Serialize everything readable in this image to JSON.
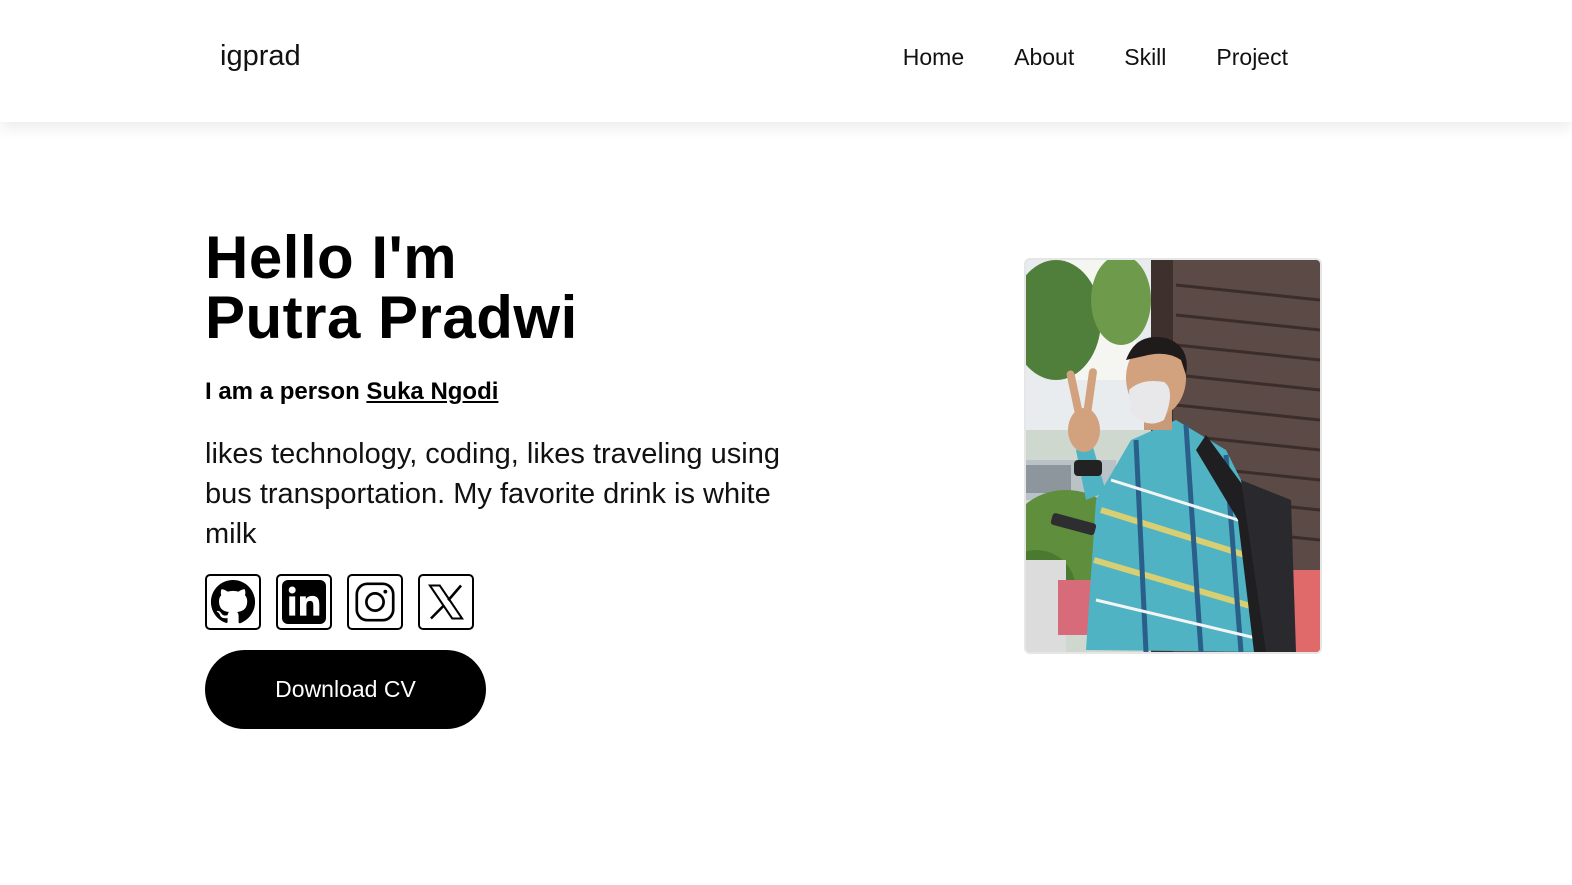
{
  "navbar": {
    "brand": "igprad",
    "links": [
      "Home",
      "About",
      "Skill",
      "Project"
    ]
  },
  "hero": {
    "title_line1": "Hello I'm",
    "title_line2": "Putra Pradwi",
    "tagline_prefix": "I am a person",
    "tagline_link": "Suka Ngodi",
    "description": "likes technology, coding, likes traveling using bus transportation. My favorite drink is white milk",
    "socials": [
      {
        "icon": "github-icon"
      },
      {
        "icon": "linkedin-icon"
      },
      {
        "icon": "instagram-icon"
      },
      {
        "icon": "x-icon"
      }
    ],
    "cta_label": "Download CV"
  },
  "profile_photo": {
    "subject": "profile-photo"
  }
}
